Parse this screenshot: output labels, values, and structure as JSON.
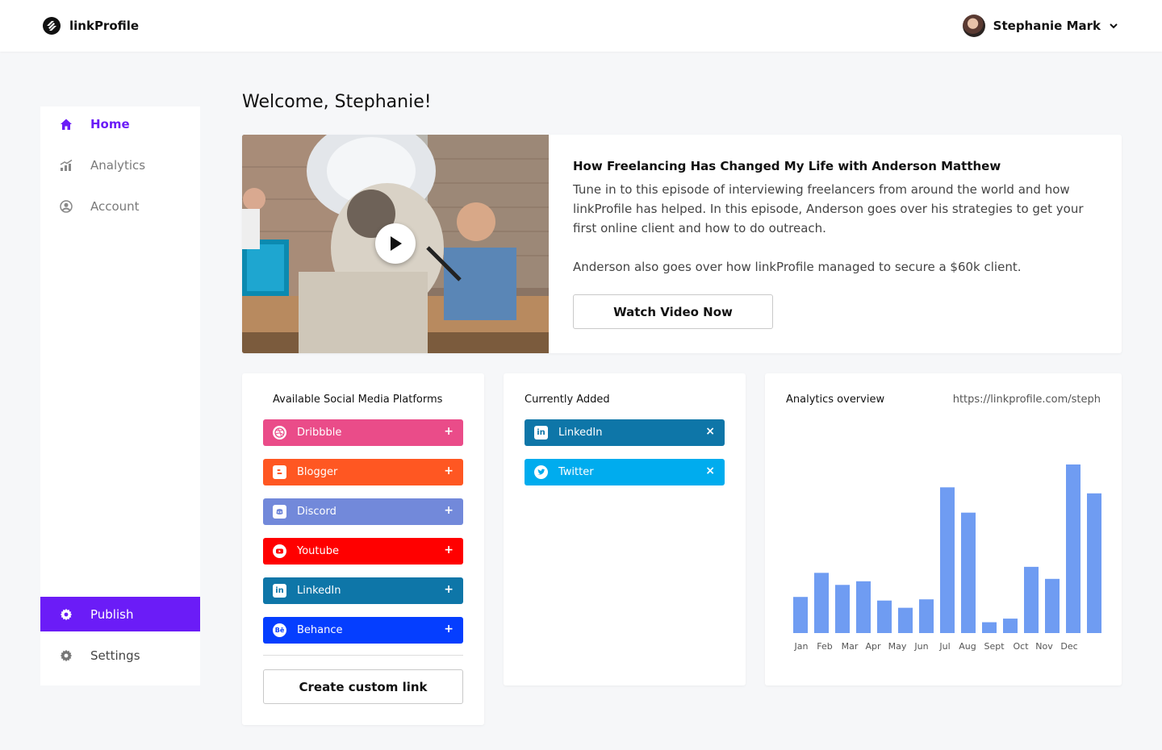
{
  "app": {
    "name": "linkProfile"
  },
  "user": {
    "name": "Stephanie Mark"
  },
  "sidebar": {
    "items": [
      {
        "label": "Home",
        "icon": "home-icon"
      },
      {
        "label": "Analytics",
        "icon": "analytics-icon"
      },
      {
        "label": "Account",
        "icon": "account-icon"
      },
      {
        "label": "Publish",
        "icon": "gear-icon"
      },
      {
        "label": "Settings",
        "icon": "gear-icon"
      }
    ]
  },
  "main": {
    "welcome": "Welcome, Stephanie!",
    "video": {
      "title": "How Freelancing Has Changed My Life with Anderson Matthew",
      "description": "Tune in to this episode of interviewing freelancers from around the world and how linkProfile has helped. In this episode, Anderson goes over his strategies to get your first online client and how to do outreach.",
      "description2": "Anderson also goes over how linkProfile managed to secure a $60k client.",
      "button": "Watch Video Now"
    },
    "platforms": {
      "title": "Available Social Media Platforms",
      "items": [
        {
          "label": "Dribbble",
          "color": "#ea4c89",
          "icon": "dribbble-icon",
          "action": "+"
        },
        {
          "label": "Blogger",
          "color": "#ff5722",
          "icon": "blogger-icon",
          "action": "+"
        },
        {
          "label": "Discord",
          "color": "#7289da",
          "icon": "discord-icon",
          "action": "+"
        },
        {
          "label": "Youtube",
          "color": "#ff0000",
          "icon": "youtube-icon",
          "action": "+"
        },
        {
          "label": "LinkedIn",
          "color": "#0e76a8",
          "icon": "linkedin-icon",
          "action": "+"
        },
        {
          "label": "Behance",
          "color": "#053eff",
          "icon": "behance-icon",
          "action": "+"
        }
      ],
      "custom_button": "Create custom link"
    },
    "added": {
      "title": "Currently Added",
      "items": [
        {
          "label": "LinkedIn",
          "color": "#0e76a8",
          "icon": "linkedin-icon",
          "action": "×"
        },
        {
          "label": "Twitter",
          "color": "#00acee",
          "icon": "twitter-icon",
          "action": "×"
        }
      ]
    },
    "analytics": {
      "title": "Analytics overview",
      "url": "https://linkprofile.com/steph"
    }
  },
  "colors": {
    "accent": "#6b1cf7",
    "bar": "#6f9cf2"
  },
  "chart_data": {
    "type": "bar",
    "categories": [
      "Jan",
      "Feb",
      "Mar",
      "Apr",
      "May",
      "Jun",
      "Jul",
      "Aug",
      "Sept",
      "Oct",
      "Nov",
      "Dec"
    ],
    "values": [
      30,
      50,
      40,
      43,
      27,
      21,
      28,
      121,
      100,
      9,
      12,
      55,
      45,
      140,
      116
    ],
    "ylim": [
      0,
      150
    ],
    "grid": false
  }
}
